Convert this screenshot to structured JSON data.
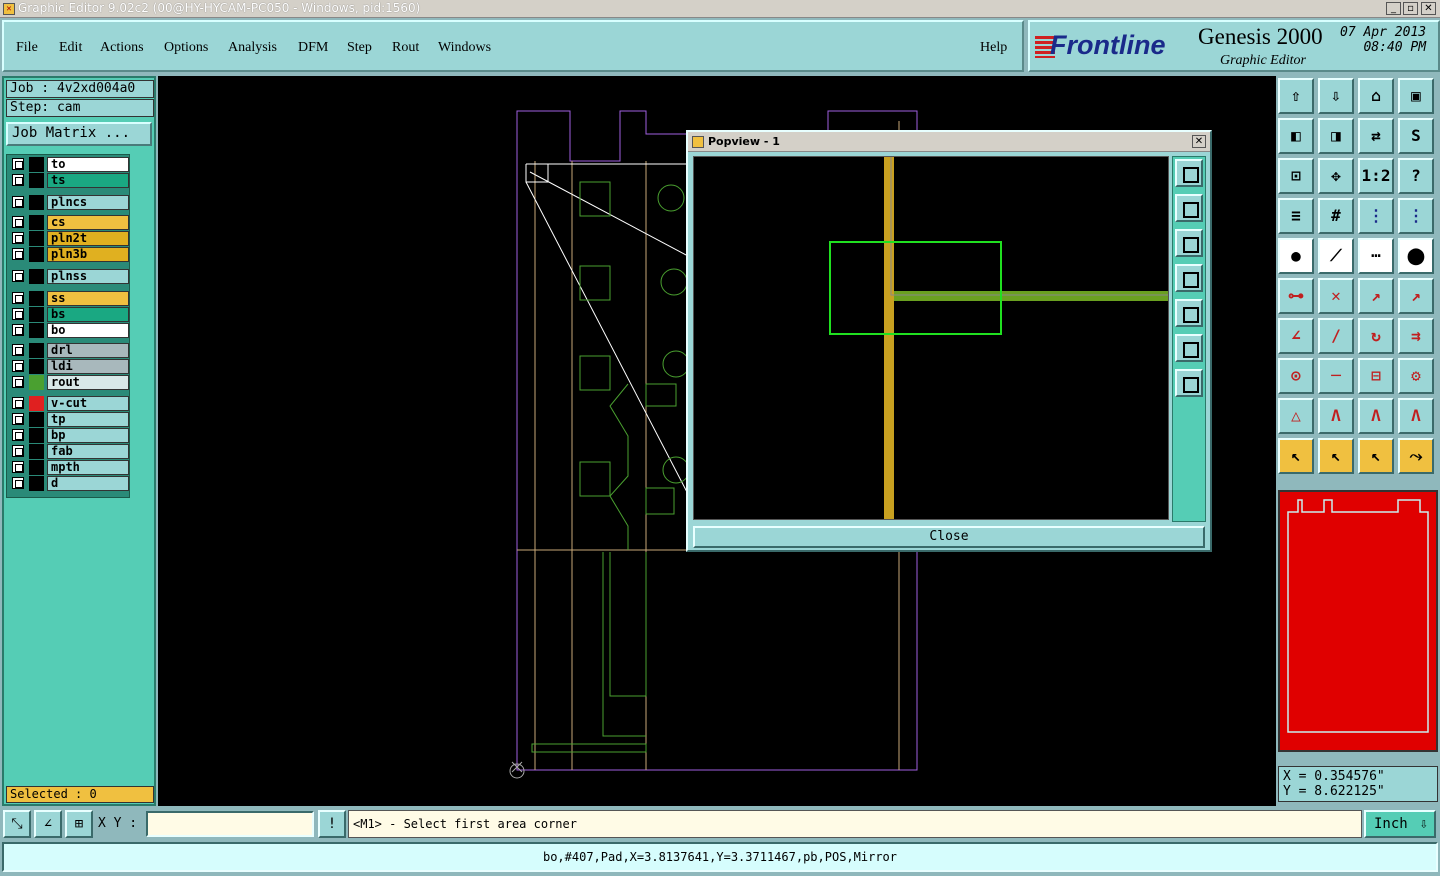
{
  "window": {
    "title": "Graphic Editor 9.02c2 (00@HY-HYCAM-PC050 - Windows, pid:1560)",
    "min": "_",
    "max": "▫",
    "close": "✕"
  },
  "menu": {
    "items": [
      "File",
      "Edit",
      "Actions",
      "Options",
      "Analysis",
      "DFM",
      "Step",
      "Rout",
      "Windows"
    ],
    "help": "Help"
  },
  "brand": {
    "logo": "Frontline",
    "product": "Genesis 2000",
    "subtitle": "Graphic Editor",
    "date": "07 Apr 2013",
    "time": "08:40 PM"
  },
  "job": {
    "label": "Job : 4v2xd004a0",
    "step": "Step: cam",
    "matrix_button": "Job Matrix ..."
  },
  "layers": [
    {
      "name": "to",
      "color": "#ffffff",
      "swatch": "#000000"
    },
    {
      "name": "ts",
      "color": "#1aa882",
      "swatch": "#000000"
    },
    {
      "name": "plncs",
      "color": "#9bd6d6",
      "swatch": "#000000"
    },
    {
      "name": "cs",
      "color": "#f0c040",
      "swatch": "#000000"
    },
    {
      "name": "pln2t",
      "color": "#e0b020",
      "swatch": "#000000"
    },
    {
      "name": "pln3b",
      "color": "#e0b020",
      "swatch": "#000000"
    },
    {
      "name": "plnss",
      "color": "#9bd6d6",
      "swatch": "#000000"
    },
    {
      "name": "ss",
      "color": "#f0c040",
      "swatch": "#000000"
    },
    {
      "name": "bs",
      "color": "#1aa882",
      "swatch": "#000000"
    },
    {
      "name": "bo",
      "color": "#ffffff",
      "swatch": "#000000"
    },
    {
      "name": "drl",
      "color": "#a8b8bc",
      "swatch": "#000000"
    },
    {
      "name": "ldi",
      "color": "#a8b8bc",
      "swatch": "#000000"
    },
    {
      "name": "rout",
      "color": "#d8e8e8",
      "swatch": "#4aa030"
    },
    {
      "name": "v-cut",
      "color": "#9bd6d6",
      "swatch": "#e02020"
    },
    {
      "name": "tp",
      "color": "#9bd6d6",
      "swatch": "#000000"
    },
    {
      "name": "bp",
      "color": "#9bd6d6",
      "swatch": "#000000"
    },
    {
      "name": "fab",
      "color": "#9bd6d6",
      "swatch": "#000000"
    },
    {
      "name": "mpth",
      "color": "#9bd6d6",
      "swatch": "#000000"
    },
    {
      "name": "d",
      "color": "#9bd6d6",
      "swatch": "#000000"
    }
  ],
  "selected": "Selected : 0",
  "popview": {
    "title": "Popview - 1",
    "close_label": "Close",
    "x_label": "✕"
  },
  "coords": {
    "x": "X = 0.354576\"",
    "y": "Y = 8.622125\""
  },
  "cmd": {
    "xy_label": "X Y :",
    "xy_value": "",
    "prompt": "<M1> - Select first area corner",
    "unit": "Inch"
  },
  "status": "bo,#407,Pad,X=3.8137641,Y=3.3711467,pb,POS,Mirror",
  "toolbar_icons": [
    "home-icon",
    "down-icon",
    "house-icon",
    "frame-icon",
    "left-icon",
    "right-icon",
    "swap-icon",
    "s-icon",
    "fit-icon",
    "center-icon",
    "ratio-icon",
    "help-icon",
    "ruler-icon",
    "grid-icon",
    "circuit-icon",
    "circuit2-icon",
    "pad-icon",
    "line-icon",
    "measure-icon",
    "dot-icon",
    "node-icon",
    "x-icon",
    "arrow-icon",
    "arrow2-icon",
    "angle-icon",
    "slash-icon",
    "rotate-icon",
    "ff-icon",
    "pin-icon",
    "bar-icon",
    "box-icon",
    "gear-icon",
    "tri-icon",
    "tri2-icon",
    "tri3-icon",
    "tri4-icon",
    "pointer-icon",
    "pointer2-icon",
    "pointer3-icon",
    "route-icon"
  ]
}
